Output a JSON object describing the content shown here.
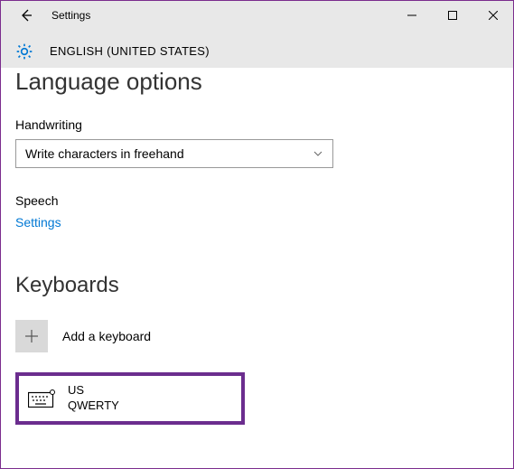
{
  "titlebar": {
    "title": "Settings"
  },
  "subheader": {
    "language": "ENGLISH (UNITED STATES)"
  },
  "page": {
    "title": "Language options",
    "handwriting_label": "Handwriting",
    "handwriting_dropdown": "Write characters in freehand",
    "speech_label": "Speech",
    "speech_link": "Settings",
    "keyboards_title": "Keyboards",
    "add_keyboard_label": "Add a keyboard",
    "keyboard": {
      "name": "US",
      "layout": "QWERTY"
    }
  }
}
